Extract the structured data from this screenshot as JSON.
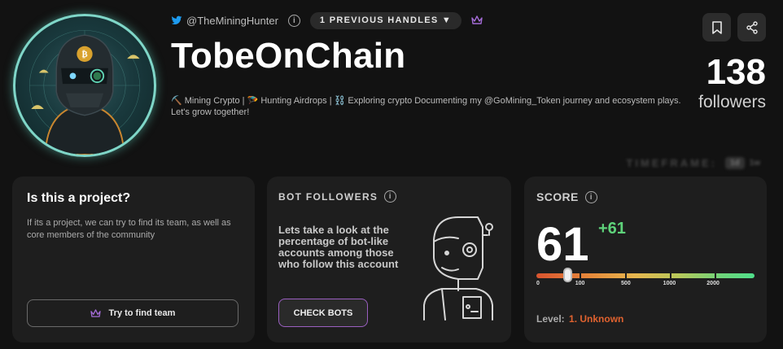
{
  "profile": {
    "twitter_handle": "@TheMiningHunter",
    "previous_handles": "1 PREVIOUS HANDLES ▼",
    "display_name": "TobeOnChain",
    "bio": "⛏️ Mining Crypto | 🪂 Hunting Airdrops | ⛓️ Exploring crypto Documenting my @GoMining_Token journey and ecosystem plays. Let's grow together!",
    "followers_count": "138",
    "followers_label": "followers"
  },
  "timeframe": {
    "label": "TIMEFRAME:",
    "value": "1d",
    "value2": "1w"
  },
  "project_card": {
    "title": "Is this a project?",
    "description": "If its a project, we can try to find its team, as well as core members of the community",
    "button_label": "Try to find team"
  },
  "bot_card": {
    "title": "BOT FOLLOWERS",
    "description": "Lets take a look at the percentage of bot-like accounts among those who follow this account",
    "button_label": "CHECK BOTS"
  },
  "score_card": {
    "title": "SCORE",
    "value": "61",
    "delta": "+61",
    "score_fraction": 0.14,
    "ticks": [
      "0",
      "100",
      "500",
      "1000",
      "2000"
    ],
    "level_label": "Level:",
    "level_value": "1. Unknown"
  },
  "colors": {
    "accent_purple": "#9a5fc0",
    "positive_green": "#5ed27a",
    "level_orange": "#e0622f",
    "twitter_blue": "#1d9bf0"
  },
  "icons": {
    "twitter": "twitter-bird-icon",
    "info": "info-icon",
    "crown": "crown-icon",
    "bookmark": "bookmark-icon",
    "share": "share-icon"
  }
}
